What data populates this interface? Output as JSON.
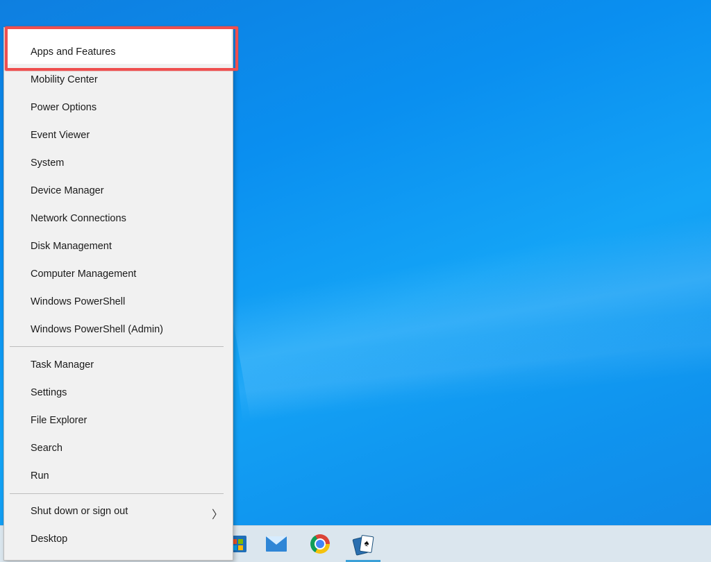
{
  "desktop": {
    "accent": "#0a8ff0"
  },
  "taskbar": {
    "icons": [
      {
        "name": "microsoft-store-icon"
      },
      {
        "name": "mail-icon"
      },
      {
        "name": "chrome-icon"
      },
      {
        "name": "solitaire-icon",
        "glyph": "♠"
      }
    ]
  },
  "context_menu": {
    "highlight_color": "#ef4f4f",
    "group1": [
      {
        "label": "Apps and Features"
      },
      {
        "label": "Mobility Center"
      },
      {
        "label": "Power Options"
      },
      {
        "label": "Event Viewer"
      },
      {
        "label": "System"
      },
      {
        "label": "Device Manager"
      },
      {
        "label": "Network Connections"
      },
      {
        "label": "Disk Management"
      },
      {
        "label": "Computer Management"
      },
      {
        "label": "Windows PowerShell"
      },
      {
        "label": "Windows PowerShell (Admin)"
      }
    ],
    "group2": [
      {
        "label": "Task Manager"
      },
      {
        "label": "Settings"
      },
      {
        "label": "File Explorer"
      },
      {
        "label": "Search"
      },
      {
        "label": "Run"
      }
    ],
    "group3": [
      {
        "label": "Shut down or sign out",
        "submenu_arrow": "〉"
      },
      {
        "label": "Desktop"
      }
    ]
  }
}
